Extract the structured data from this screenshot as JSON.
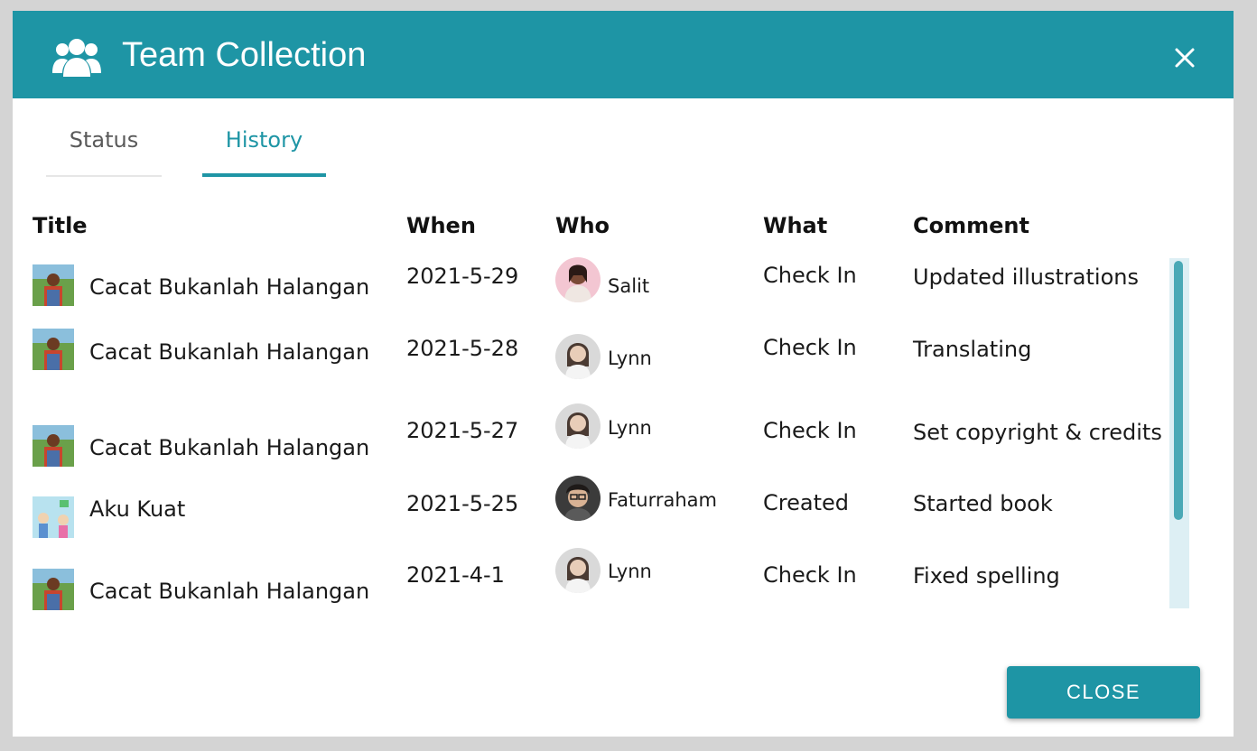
{
  "dialog": {
    "title": "Team Collection",
    "close_icon": "close-x-icon",
    "team_icon": "team-icon"
  },
  "tabs": [
    {
      "label": "Status",
      "active": false
    },
    {
      "label": "History",
      "active": true
    }
  ],
  "table": {
    "headers": {
      "title": "Title",
      "when": "When",
      "who": "Who",
      "what": "What",
      "comment": "Comment"
    },
    "rows": [
      {
        "title": "Cacat Bukanlah Halangan",
        "when": "2021-5-29",
        "who": "Salit",
        "what": "Check In",
        "comment": "Updated illustrations"
      },
      {
        "title": "Cacat Bukanlah Halangan",
        "when": "2021-5-28",
        "who": "Lynn",
        "what": "Check In",
        "comment": "Translating"
      },
      {
        "title": "Cacat Bukanlah Halangan",
        "when": "2021-5-27",
        "who": "Lynn",
        "what": "Check In",
        "comment": "Set copyright & credits"
      },
      {
        "title": "Aku Kuat",
        "when": "2021-5-25",
        "who": "Faturraham",
        "what": "Created",
        "comment": "Started book"
      },
      {
        "title": "Cacat Bukanlah Halangan",
        "when": "2021-4-1",
        "who": "Lynn",
        "what": "Check In",
        "comment": "Fixed spelling"
      }
    ]
  },
  "footer": {
    "close_label": "CLOSE"
  },
  "colors": {
    "accent": "#1e95a5",
    "background": "#d4d4d4",
    "scrollbar_track": "#ddeff4"
  }
}
